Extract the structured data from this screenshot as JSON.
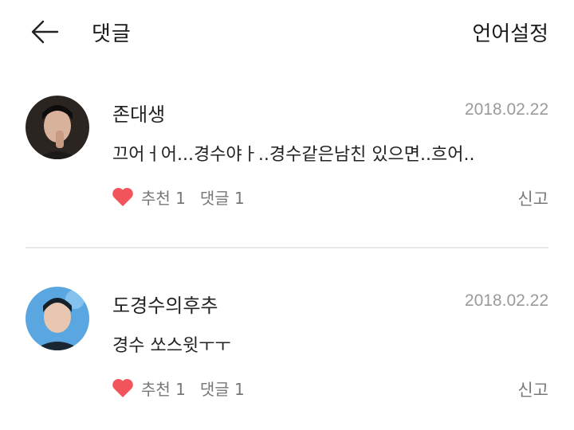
{
  "header": {
    "title": "댓글",
    "language_label": "언어설정"
  },
  "comments": [
    {
      "author": "존대생",
      "date": "2018.02.22",
      "text": "끄어ㅓ어...경수야ㅏ..경수같은남친 있으면..흐어..",
      "like_label": "추천 1",
      "reply_label": "댓글 1",
      "report_label": "신고"
    },
    {
      "author": "도경수의후추",
      "date": "2018.02.22",
      "text": "경수 쏘스윗ㅜㅜ",
      "like_label": "추천 1",
      "reply_label": "댓글 1",
      "report_label": "신고"
    }
  ],
  "colors": {
    "heart": "#f2545b",
    "meta": "#9a9a9a",
    "divider": "#e9e9e9"
  }
}
